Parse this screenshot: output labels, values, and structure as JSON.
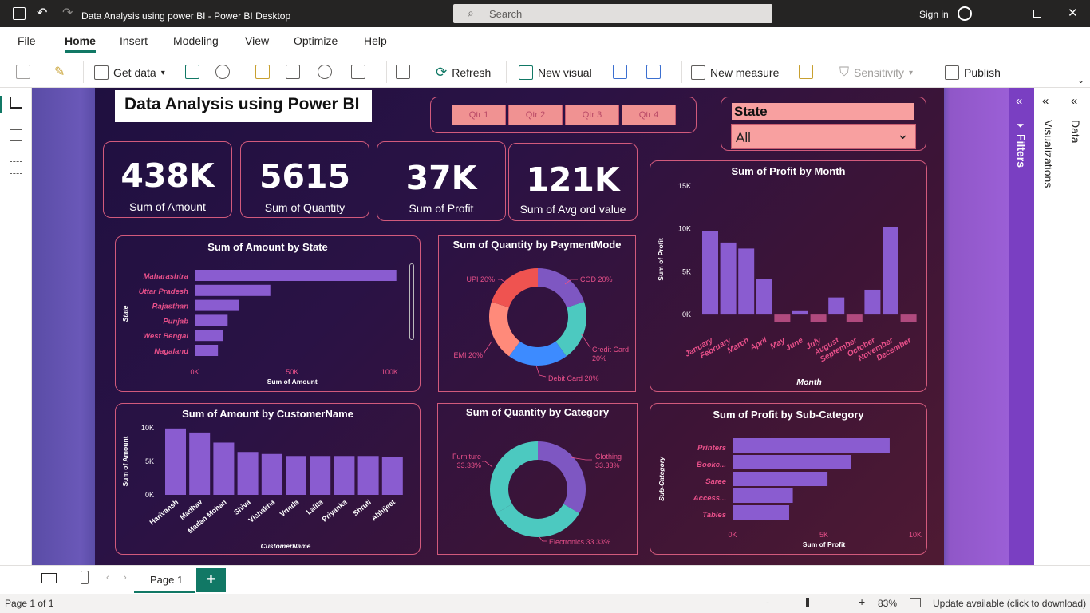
{
  "window": {
    "title": "Data Analysis using power BI - Power BI Desktop",
    "search_placeholder": "Search",
    "sign_in": "Sign in"
  },
  "tabs": [
    "File",
    "Home",
    "Insert",
    "Modeling",
    "View",
    "Optimize",
    "Help"
  ],
  "ribbon": {
    "get_data": "Get data",
    "refresh": "Refresh",
    "new_visual": "New visual",
    "new_measure": "New measure",
    "sensitivity": "Sensitivity",
    "publish": "Publish"
  },
  "report": {
    "title": "Data Analysis using Power BI",
    "quarters": [
      "Qtr 1",
      "Qtr 2",
      "Qtr 3",
      "Qtr 4"
    ],
    "state_slicer": {
      "label": "State",
      "value": "All"
    },
    "kpis": [
      {
        "value": "438K",
        "label": "Sum of Amount"
      },
      {
        "value": "5615",
        "label": "Sum of Quantity"
      },
      {
        "value": "37K",
        "label": "Sum of Profit"
      },
      {
        "value": "121K",
        "label": "Sum of Avg ord value"
      }
    ],
    "visual_titles": {
      "amount_by_state": "Sum of Amount by State",
      "qty_by_payment": "Sum of Quantity by PaymentMode",
      "profit_by_month": "Sum of Profit by Month",
      "amount_by_customer": "Sum of Amount by CustomerName",
      "qty_by_category": "Sum of Quantity by Category",
      "profit_by_subcat": "Sum of Profit by Sub-Category"
    }
  },
  "chart_data": [
    {
      "type": "bar",
      "orientation": "horizontal",
      "title": "Sum of Amount by State",
      "categories": [
        "Maharashtra",
        "Uttar Pradesh",
        "Rajasthan",
        "Punjab",
        "West Bengal",
        "Nagaland"
      ],
      "values": [
        104000,
        39000,
        23000,
        17000,
        14500,
        12000
      ],
      "xlabel": "Sum of Amount",
      "ylabel": "State",
      "xticks": [
        "0K",
        "50K",
        "100K"
      ],
      "xlim": [
        0,
        107000
      ],
      "color": "#8a5cd0"
    },
    {
      "type": "pie",
      "donut": true,
      "title": "Sum of Quantity by PaymentMode",
      "categories": [
        "COD",
        "Credit Card",
        "Debit Card",
        "EMI",
        "UPI"
      ],
      "labels": [
        "COD 20%",
        "Credit Card 20%",
        "Debit Card 20%",
        "EMI 20%",
        "UPI 20%"
      ],
      "values": [
        20,
        20,
        20,
        20,
        20
      ],
      "colors": [
        "#7e57c2",
        "#4cc9c0",
        "#3d8bff",
        "#ff8a7a",
        "#ef5350"
      ]
    },
    {
      "type": "bar",
      "title": "Sum of Profit by Month",
      "categories": [
        "January",
        "February",
        "March",
        "April",
        "May",
        "June",
        "July",
        "August",
        "September",
        "October",
        "November",
        "December"
      ],
      "values": [
        9700,
        8400,
        7700,
        4200,
        -900,
        400,
        -900,
        2000,
        -900,
        2900,
        10200,
        -900
      ],
      "xlabel": "Month",
      "ylabel": "Sum of Profit",
      "yticks": [
        "15K",
        "10K",
        "5K",
        "0K"
      ],
      "ylim": [
        -1200,
        15000
      ],
      "color_pos": "#8a5cd0",
      "color_neg": "#b04a7e"
    },
    {
      "type": "bar",
      "title": "Sum of Amount by CustomerName",
      "categories": [
        "Harivansh",
        "Madhav",
        "Madan Mohan",
        "Shiva",
        "Vishakha",
        "Vrinda",
        "Lalita",
        "Priyanka",
        "Shruti",
        "Abhijeet"
      ],
      "values": [
        9900,
        9300,
        7800,
        6400,
        6100,
        5800,
        5800,
        5800,
        5800,
        5700
      ],
      "xlabel": "CustomerName",
      "ylabel": "Sum of Amount",
      "yticks": [
        "10K",
        "5K",
        "0K"
      ],
      "ylim": [
        0,
        10000
      ],
      "color": "#8a5cd0"
    },
    {
      "type": "pie",
      "donut": true,
      "title": "Sum of Quantity by Category",
      "categories": [
        "Clothing",
        "Electronics",
        "Furniture"
      ],
      "labels": [
        "Clothing 33.33%",
        "Electronics 33.33%",
        "Furniture 33.33%"
      ],
      "values": [
        33.33,
        33.33,
        33.33
      ],
      "colors": [
        "#7e57c2",
        "#4cc9c0",
        "#4cc9c0"
      ]
    },
    {
      "type": "bar",
      "orientation": "horizontal",
      "title": "Sum of Profit by Sub-Category",
      "categories": [
        "Printers",
        "Bookc...",
        "Saree",
        "Access...",
        "Tables"
      ],
      "values": [
        8600,
        6500,
        5200,
        3300,
        3100
      ],
      "xlabel": "Sum of Profit",
      "ylabel": "Sub-Category",
      "xticks": [
        "0K",
        "5K",
        "10K"
      ],
      "xlim": [
        0,
        10000
      ],
      "color": "#8a5cd0"
    }
  ],
  "panes": {
    "filters": "Filters",
    "visualizations": "Visualizations",
    "data": "Data"
  },
  "pages": {
    "current": "Page 1"
  },
  "status": {
    "page": "Page 1 of 1",
    "zoom": "83%",
    "update": "Update available (click to download)"
  }
}
